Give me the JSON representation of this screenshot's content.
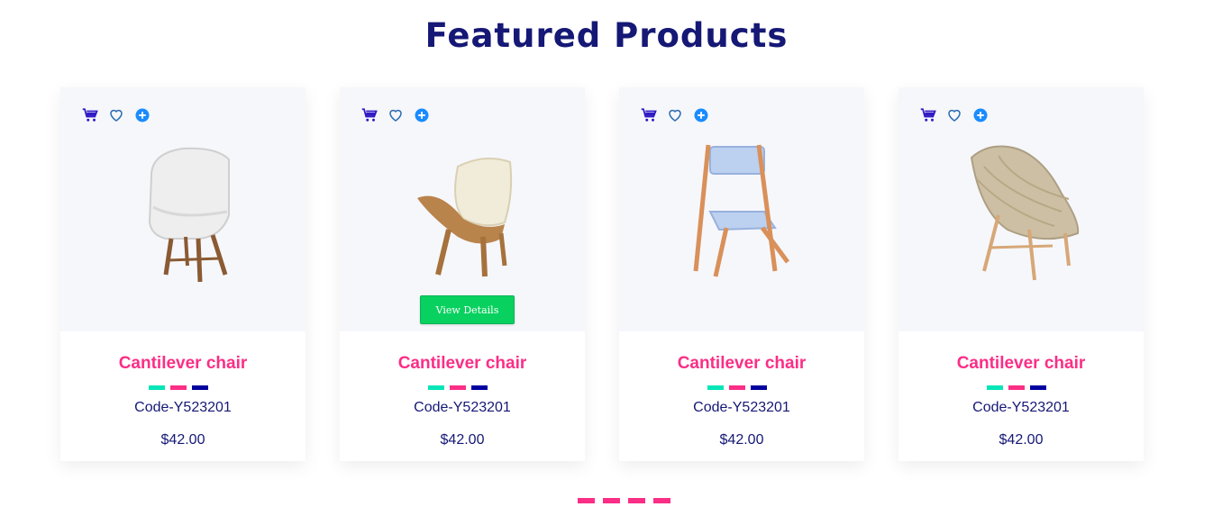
{
  "page": {
    "title": "Featured Products"
  },
  "colors": {
    "accent": "#fb2e86",
    "navy": "#151875",
    "green": "#08d15f",
    "icon_dark": "#2f1ac4",
    "icon_blue": "#2b6cb0"
  },
  "cards": [
    {
      "name": "Cantilever chair",
      "code": "Code-Y523201",
      "price": "$42.00",
      "image": "white-shell-chair",
      "swatches": [
        "#05e6b7",
        "#fb2e86",
        "#00009f"
      ],
      "show_button": false
    },
    {
      "name": "Cantilever chair",
      "code": "Code-Y523201",
      "price": "$42.00",
      "image": "wing-lounge-chair",
      "swatches": [
        "#05e6b7",
        "#fb2e86",
        "#00009f"
      ],
      "show_button": true,
      "button_label": "View Details"
    },
    {
      "name": "Cantilever chair",
      "code": "Code-Y523201",
      "price": "$42.00",
      "image": "folding-padded-chair",
      "swatches": [
        "#05e6b7",
        "#fb2e86",
        "#00009f"
      ],
      "show_button": false
    },
    {
      "name": "Cantilever chair",
      "code": "Code-Y523201",
      "price": "$42.00",
      "image": "woven-lounge-chair",
      "swatches": [
        "#05e6b7",
        "#fb2e86",
        "#00009f"
      ],
      "show_button": false
    }
  ],
  "icons": [
    "cart-icon",
    "heart-icon",
    "zoom-plus-icon"
  ],
  "pagination": {
    "count": 4,
    "active": 0
  }
}
